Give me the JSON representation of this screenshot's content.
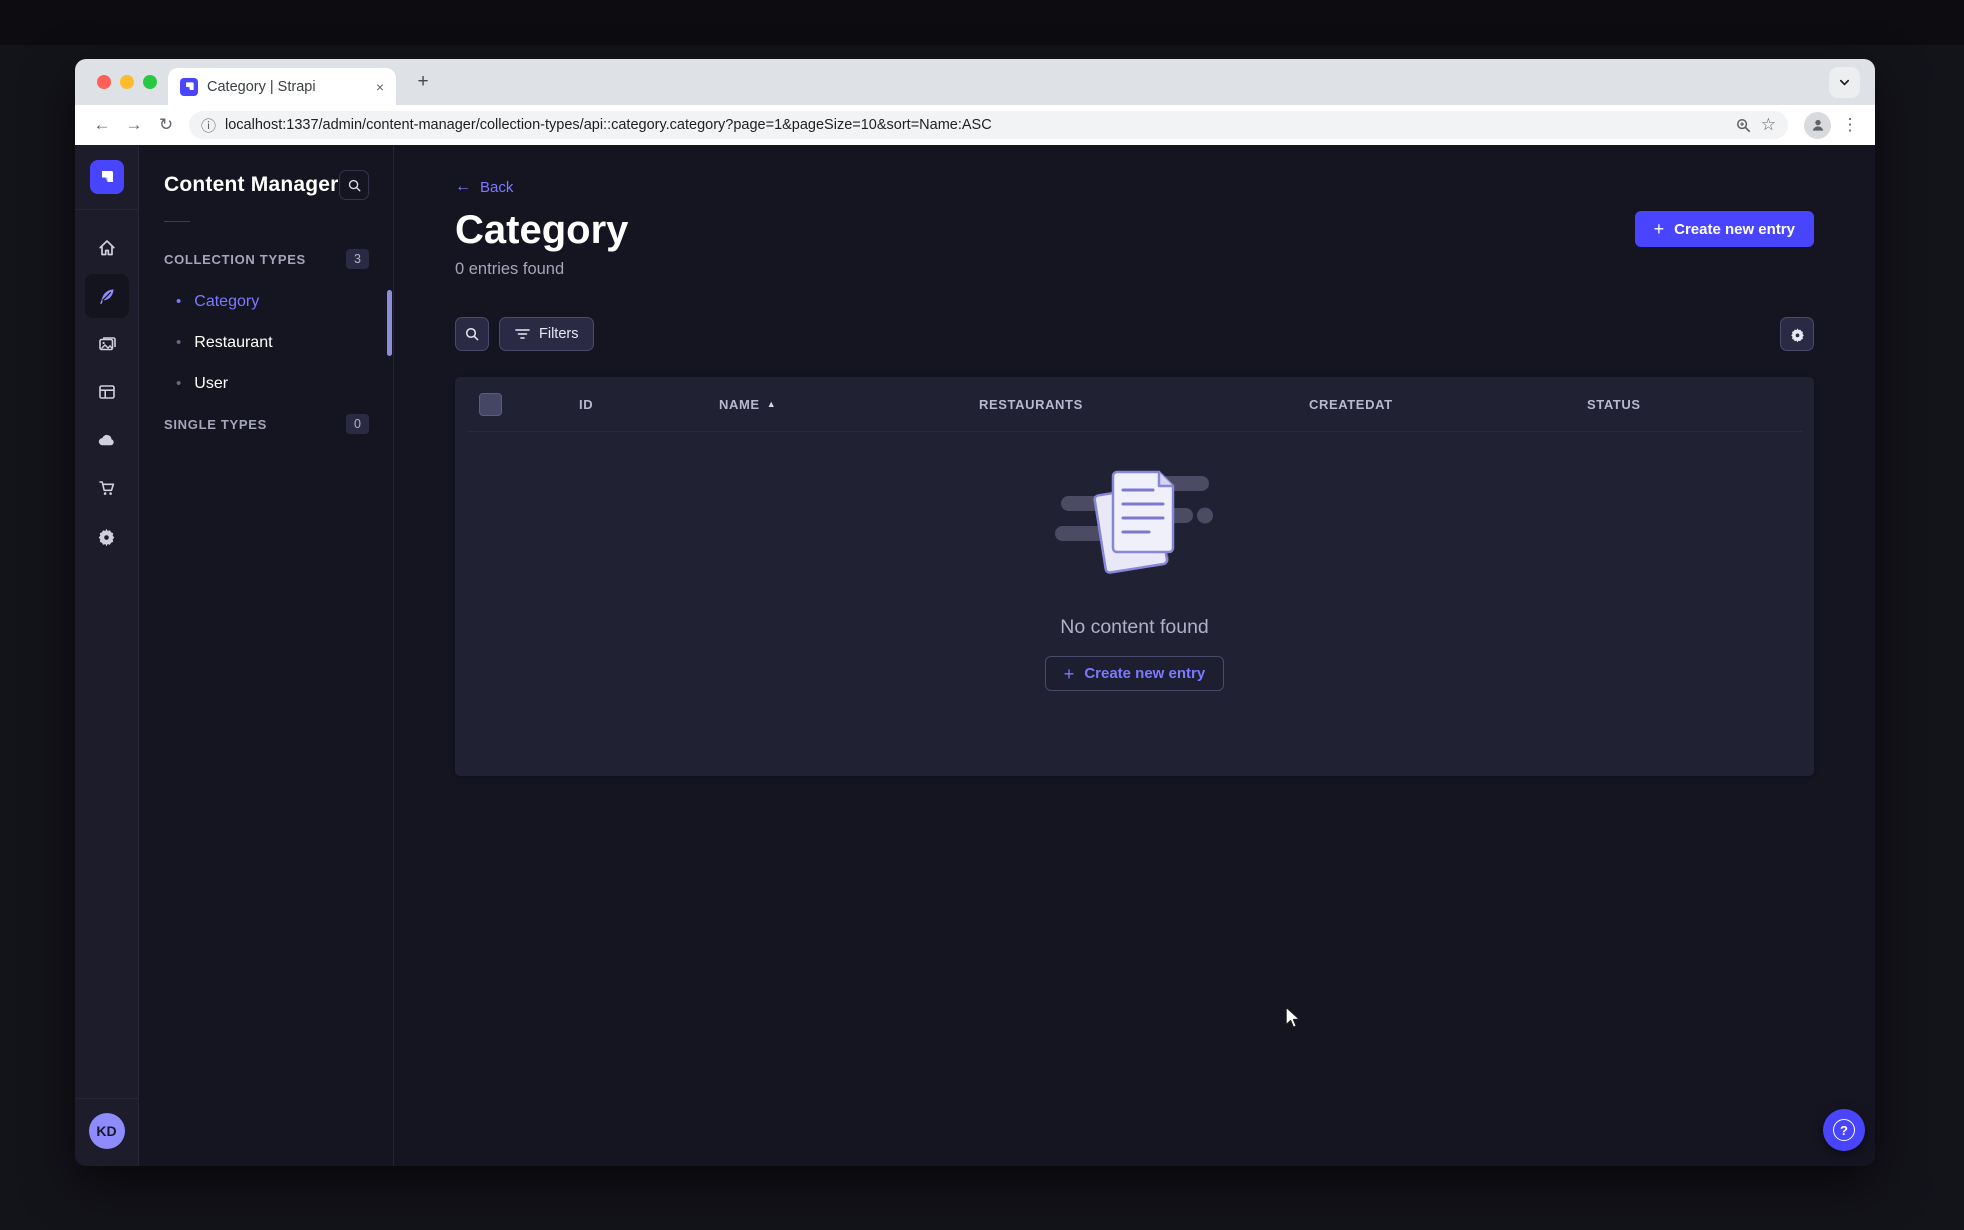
{
  "browser": {
    "tab": {
      "title": "Category | Strapi"
    },
    "url": "localhost:1337/admin/content-manager/collection-types/api::category.category?page=1&pageSize=10&sort=Name:ASC"
  },
  "icons": {
    "plus": "+",
    "close": "×",
    "back_arrow": "←",
    "forward_arrow": "→",
    "reload": "↻",
    "info": "ⓘ",
    "star": "☆",
    "menu_dots": "⋮",
    "help": "?",
    "bullet": "•",
    "sort_asc": "▲"
  },
  "sidebar": {
    "items": [
      {
        "name": "home"
      },
      {
        "name": "content-manager",
        "active": true
      },
      {
        "name": "media-library"
      },
      {
        "name": "content-type-builder"
      },
      {
        "name": "deploy"
      },
      {
        "name": "marketplace"
      },
      {
        "name": "settings"
      }
    ],
    "user_initials": "KD"
  },
  "content_manager_panel": {
    "title": "Content Manager",
    "sections": [
      {
        "label": "COLLECTION TYPES",
        "count": "3",
        "items": [
          {
            "label": "Category",
            "active": true
          },
          {
            "label": "Restaurant",
            "active": false
          },
          {
            "label": "User",
            "active": false
          }
        ]
      },
      {
        "label": "SINGLE TYPES",
        "count": "0",
        "items": []
      }
    ]
  },
  "main": {
    "back_label": "Back",
    "title": "Category",
    "subtitle": "0 entries found",
    "create_button_label": "Create new entry",
    "filters_button_label": "Filters",
    "table": {
      "headers": [
        "ID",
        "NAME",
        "RESTAURANTS",
        "CREATEDAT",
        "STATUS"
      ],
      "sorted_by": "NAME",
      "sort_direction": "ASC"
    },
    "empty_state": {
      "message": "No content found",
      "create_button_label": "Create new entry"
    }
  },
  "colors": {
    "accent": "#4945ff",
    "accent_light": "#7b79ff",
    "app_background": "#151522",
    "rail_background": "#1c1c2a",
    "card_background": "#212134",
    "chrome_background": "#dee1e6",
    "text_muted": "#a5a5ba"
  }
}
